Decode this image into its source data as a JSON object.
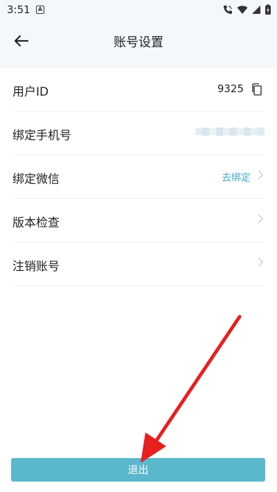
{
  "status_bar": {
    "time": "3:51",
    "notification_badge": "A",
    "icons": [
      "phone-wifi-icon",
      "wifi-icon",
      "signal-icon",
      "battery-icon"
    ]
  },
  "header": {
    "title": "账号设置",
    "back_icon": "back-arrow-icon"
  },
  "rows": [
    {
      "label": "用户ID",
      "value": "9325",
      "action_icon": "copy-icon"
    },
    {
      "label": "绑定手机号",
      "value_state": "blurred"
    },
    {
      "label": "绑定微信",
      "link": "去绑定",
      "action_icon": "chevron-right-icon"
    },
    {
      "label": "版本检查",
      "action_icon": "chevron-right-icon"
    },
    {
      "label": "注销账号",
      "action_icon": "chevron-right-icon"
    }
  ],
  "logout": {
    "label": "退出"
  },
  "colors": {
    "header_bg": "#f2f8fb",
    "accent_link": "#42a9c9",
    "logout_button": "#5bb7cc",
    "annotation_arrow": "#e81f1f"
  },
  "annotation": {
    "icon": "red-arrow-annotation",
    "points_to": "logout-button"
  }
}
